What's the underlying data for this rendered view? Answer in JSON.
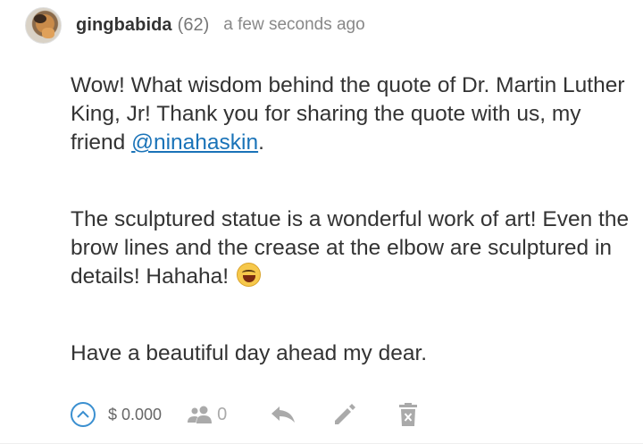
{
  "comment": {
    "author": "gingbabida",
    "reputation": "(62)",
    "timestamp": "a few seconds ago",
    "paragraphs": {
      "p1_text": "Wow! What wisdom behind the quote of Dr. Martin Luther King, Jr! Thank you for sharing the quote with us, my friend ",
      "p1_mention": "@ninahaskin",
      "p1_end": ".",
      "p2_text": "The sculptured statue is a wonderful work of art! Even the brow lines and the crease at the elbow are sculptured in details! Hahaha! ",
      "p2_emoji": "grinning-squinting-face-emoji",
      "p3_text": "Have a beautiful day ahead my dear."
    }
  },
  "footer": {
    "payout": "$ 0.000",
    "voters_count": "0",
    "icons": [
      "upvote-icon",
      "voters-icon",
      "reply-icon",
      "edit-icon",
      "delete-icon"
    ]
  },
  "colors": {
    "mention": "#1a73b8",
    "upvote": "#3a8fd0",
    "muted_icon": "#aaaaaa"
  }
}
